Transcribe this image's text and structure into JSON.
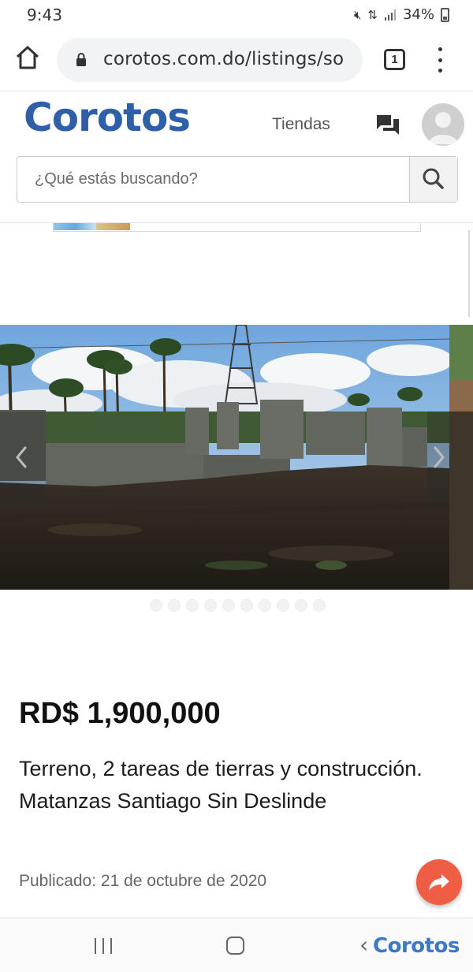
{
  "status_bar": {
    "time": "9:43",
    "battery_percent": "34%",
    "icons": [
      "mute-icon",
      "data-icon",
      "signal-icon",
      "battery-icon"
    ]
  },
  "browser": {
    "url": "corotos.com.do/listings/so",
    "tab_count": "1",
    "icons": [
      "home-icon",
      "lock-icon",
      "tabs-icon",
      "more-vert-icon"
    ]
  },
  "site": {
    "logo": "Corotos",
    "nav_tiendas": "Tiendas",
    "search_placeholder": "¿Qué estás buscando?",
    "icons": [
      "chat-icon",
      "avatar-icon",
      "search-icon"
    ]
  },
  "gallery": {
    "image_count": 10,
    "active_index": 0
  },
  "listing": {
    "price": "RD$ 1,900,000",
    "title": "Terreno, 2 tareas de tierras y construcción. Matanzas Santiago Sin Deslinde",
    "published": "Publicado: 21 de octubre de 2020"
  },
  "share_button": {
    "icon": "share-icon",
    "color": "#ef5d44"
  },
  "nav_bar": {
    "brand": "Corotos",
    "icons": [
      "recents-icon",
      "home-nav-icon",
      "back-icon"
    ]
  },
  "colors": {
    "brand_blue": "#2f5fa8",
    "share_orange": "#ef5d44"
  }
}
